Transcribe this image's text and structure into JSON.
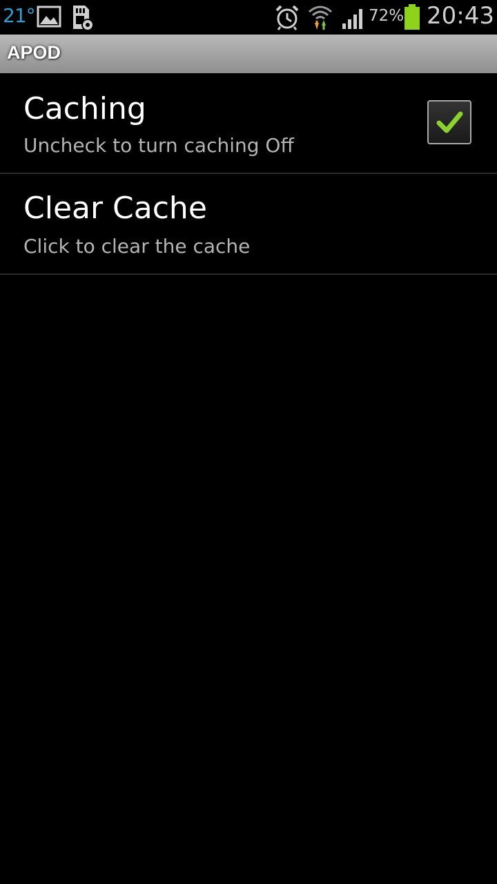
{
  "status_bar": {
    "temperature": "21°",
    "battery_percent": "72%",
    "time": "20:43",
    "icons": [
      "image-icon",
      "sd-card-settings-icon",
      "alarm-icon",
      "wifi-icon",
      "signal-icon",
      "battery-icon"
    ],
    "colors": {
      "temperature": "#2e9fd8",
      "battery": "#8ed21a",
      "wifi_up": "#7ac943",
      "wifi_down": "#f0a030"
    }
  },
  "app_bar": {
    "title": "APOD"
  },
  "preferences": [
    {
      "title": "Caching",
      "summary": "Uncheck to turn caching Off",
      "checked": true
    },
    {
      "title": "Clear Cache",
      "summary": "Click to clear the cache"
    }
  ],
  "colors": {
    "checkmark": "#8bd12f",
    "background": "#000000"
  }
}
